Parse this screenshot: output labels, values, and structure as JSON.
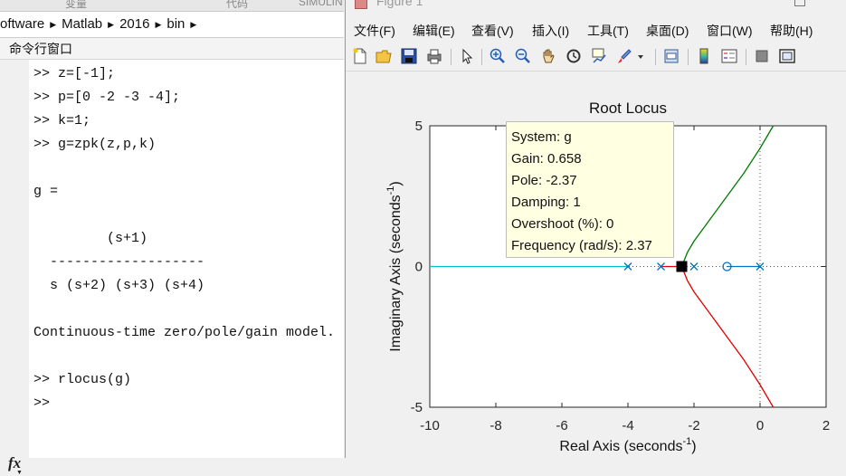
{
  "desktop": {
    "top_tabs": [
      "变量",
      "代码",
      "SIMULIN"
    ],
    "address": [
      "oftware",
      "Matlab",
      "2016",
      "bin"
    ],
    "command_window_title": "命令行窗口",
    "fx_label": "fx"
  },
  "command_lines": [
    ">> z=[-1];",
    ">> p=[0 -2 -3 -4];",
    ">> k=1;",
    ">> g=zpk(z,p,k)",
    "",
    "g =",
    "",
    "         (s+1)",
    "  -------------------",
    "  s (s+2) (s+3) (s+4)",
    "",
    "Continuous-time zero/pole/gain model.",
    "",
    ">> rlocus(g)",
    ">> "
  ],
  "figure": {
    "title": "Figure 1",
    "menu": [
      "文件(F)",
      "编辑(E)",
      "查看(V)",
      "插入(I)",
      "工具(T)",
      "桌面(D)",
      "窗口(W)",
      "帮助(H)"
    ],
    "toolbar_icons": [
      "new-figure-icon",
      "open-file-icon",
      "save-icon",
      "print-icon",
      "edit-plot-arrow-icon",
      "zoom-in-icon",
      "zoom-out-icon",
      "pan-hand-icon",
      "rotate-3d-icon",
      "data-cursor-icon",
      "brush-icon",
      "brush-dropdown-icon",
      "link-plot-icon",
      "insert-colorbar-icon",
      "insert-legend-icon",
      "hide-plot-tools-icon",
      "show-plot-tools-icon"
    ],
    "colors": {
      "accent_blue": "#0072bd",
      "cyan_branch": "#00bcd4",
      "green_branch": "#007a00",
      "red_branch": "#e00000",
      "datatip_bg": "#ffffe1"
    }
  },
  "datatip": {
    "system": "System: g",
    "gain": "Gain: 0.658",
    "pole": "Pole: -2.37",
    "damping": "Damping: 1",
    "overshoot": "Overshoot (%): 0",
    "frequency": "Frequency (rad/s): 2.37"
  },
  "chart_data": {
    "type": "line",
    "title": "Root Locus",
    "xlabel": "Real Axis (seconds",
    "ylabel": "Imaginary Axis (seconds",
    "axis_label_superscript": "-1",
    "axis_label_close": ")",
    "xlim": [
      -10,
      2
    ],
    "ylim": [
      -5,
      5
    ],
    "xticks": [
      -10,
      -8,
      -6,
      -4,
      -2,
      0,
      2
    ],
    "yticks": [
      -5,
      0,
      5
    ],
    "poles": [
      0,
      -2,
      -3,
      -4
    ],
    "zeros": [
      -1
    ],
    "breakaway_point": [
      -2.37,
      0
    ],
    "series": [
      {
        "color": "#00bcd4",
        "x": [
          -4,
          -10
        ],
        "y": [
          0,
          0
        ]
      },
      {
        "color": "#e00000",
        "x": [
          -3,
          -2.37
        ],
        "y": [
          0,
          0
        ]
      },
      {
        "color": "#e00000",
        "x": [
          -2.37,
          -2.2,
          -2.0,
          -1.5,
          -1.0,
          -0.5,
          0,
          0.4
        ],
        "y": [
          0,
          -0.5,
          -0.9,
          -1.7,
          -2.5,
          -3.3,
          -4.2,
          -5.0
        ]
      },
      {
        "color": "#007a00",
        "x": [
          -2.37,
          -2.2,
          -2.0,
          -1.5,
          -1.0,
          -0.5,
          0,
          0.4
        ],
        "y": [
          0,
          0.5,
          0.9,
          1.7,
          2.5,
          3.3,
          4.2,
          5.0
        ]
      },
      {
        "color": "#0072bd",
        "x": [
          0,
          -1
        ],
        "y": [
          0,
          0
        ]
      }
    ]
  }
}
